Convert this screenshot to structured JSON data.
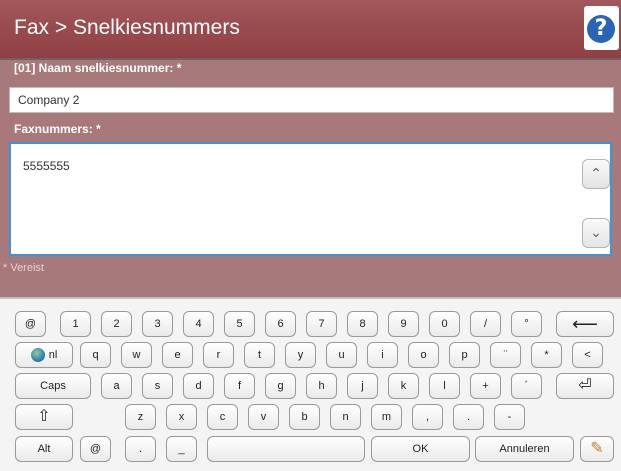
{
  "header": {
    "title": "Fax > Snelkiesnummers",
    "help_glyph": "?"
  },
  "form": {
    "name_label": "[01] Naam snelkiesnummer: *",
    "name_value": "Company 2",
    "fax_label": "Faxnummers: *",
    "fax_value": "5555555",
    "required_note": "* Vereist"
  },
  "scroll": {
    "up": "⌃",
    "down": "⌄"
  },
  "keyboard": {
    "rows": [
      [
        "@",
        "1",
        "2",
        "3",
        "4",
        "5",
        "6",
        "7",
        "8",
        "9",
        "0",
        "/",
        "°",
        "⟵"
      ],
      [
        "nl",
        "q",
        "w",
        "e",
        "r",
        "t",
        "y",
        "u",
        "i",
        "o",
        "p",
        "¨",
        "*",
        "<"
      ],
      [
        "Caps",
        "a",
        "s",
        "d",
        "f",
        "g",
        "h",
        "j",
        "k",
        "l",
        "+",
        "´",
        "⏎"
      ],
      [
        "⇧",
        "z",
        "x",
        "c",
        "v",
        "b",
        "n",
        "m",
        ",",
        ".",
        "-"
      ],
      [
        "Alt",
        "@",
        ".",
        "_",
        "",
        "OK",
        "Annuleren",
        "✎"
      ]
    ]
  }
}
